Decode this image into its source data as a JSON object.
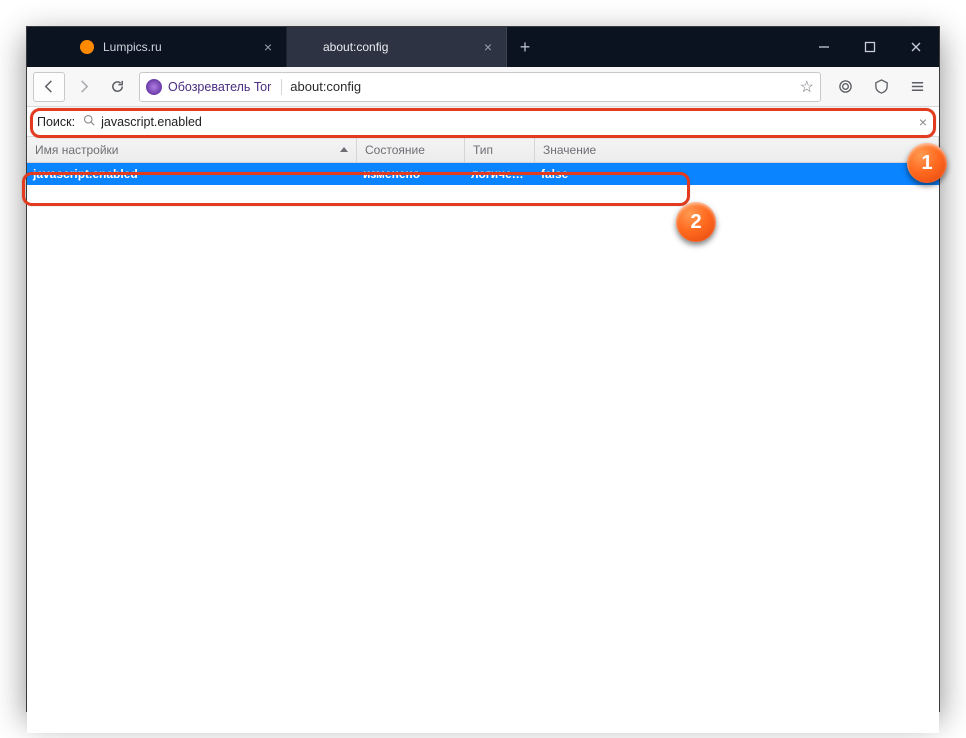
{
  "tabs": [
    {
      "title": "Lumpics.ru",
      "favicon_color": "#ff8a00"
    },
    {
      "title": "about:config",
      "favicon_color": ""
    }
  ],
  "active_tab_index": 1,
  "toolbar": {
    "identity_label": "Обозреватель Tor",
    "url_value": "about:config"
  },
  "config": {
    "search_label": "Поиск:",
    "search_value": "javascript.enabled",
    "columns": {
      "name": "Имя настройки",
      "state": "Состояние",
      "type": "Тип",
      "value": "Значение"
    },
    "rows": [
      {
        "name": "javascript.enabled",
        "state": "изменено",
        "type": "логическ...",
        "value": "false"
      }
    ]
  },
  "annotations": {
    "badge1": "1",
    "badge2": "2"
  }
}
